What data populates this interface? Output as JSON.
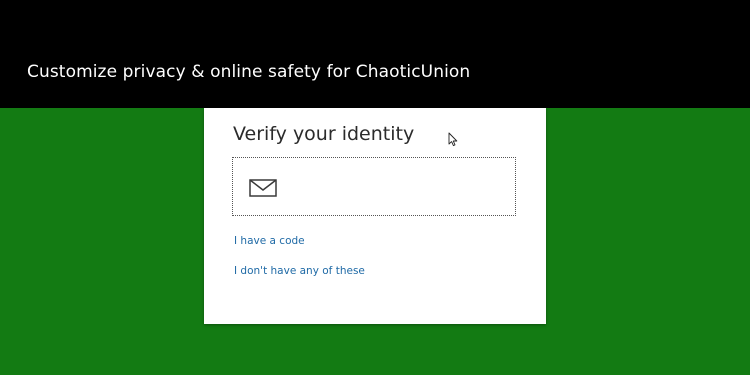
{
  "header": {
    "title": "Customize privacy & online safety for ChaoticUnion"
  },
  "dialog": {
    "title": "Verify your identity",
    "email_option_icon": "mail-icon",
    "links": {
      "have_code": "I have a code",
      "none_of_these": "I don't have any of these"
    }
  },
  "colors": {
    "background": "#137b13",
    "header": "#000000",
    "card": "#ffffff",
    "link": "#1f6aa6"
  }
}
